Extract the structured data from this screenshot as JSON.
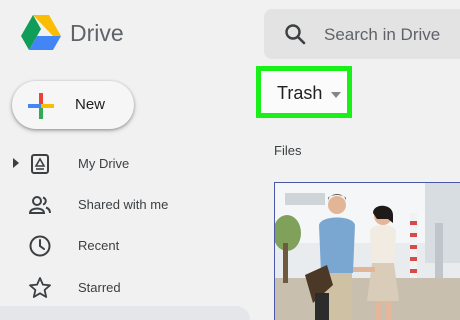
{
  "header": {
    "app_name": "Drive",
    "search": {
      "placeholder": "Search in Drive"
    }
  },
  "new_button": {
    "label": "New"
  },
  "sidebar": {
    "items": [
      {
        "label": "My Drive",
        "icon": "my-drive-icon"
      },
      {
        "label": "Shared with me",
        "icon": "people-icon"
      },
      {
        "label": "Recent",
        "icon": "clock-icon"
      },
      {
        "label": "Starred",
        "icon": "star-icon"
      }
    ]
  },
  "main": {
    "location_dropdown": {
      "label": "Trash"
    },
    "section_heading": "Files",
    "highlight_color": "#18f018"
  }
}
